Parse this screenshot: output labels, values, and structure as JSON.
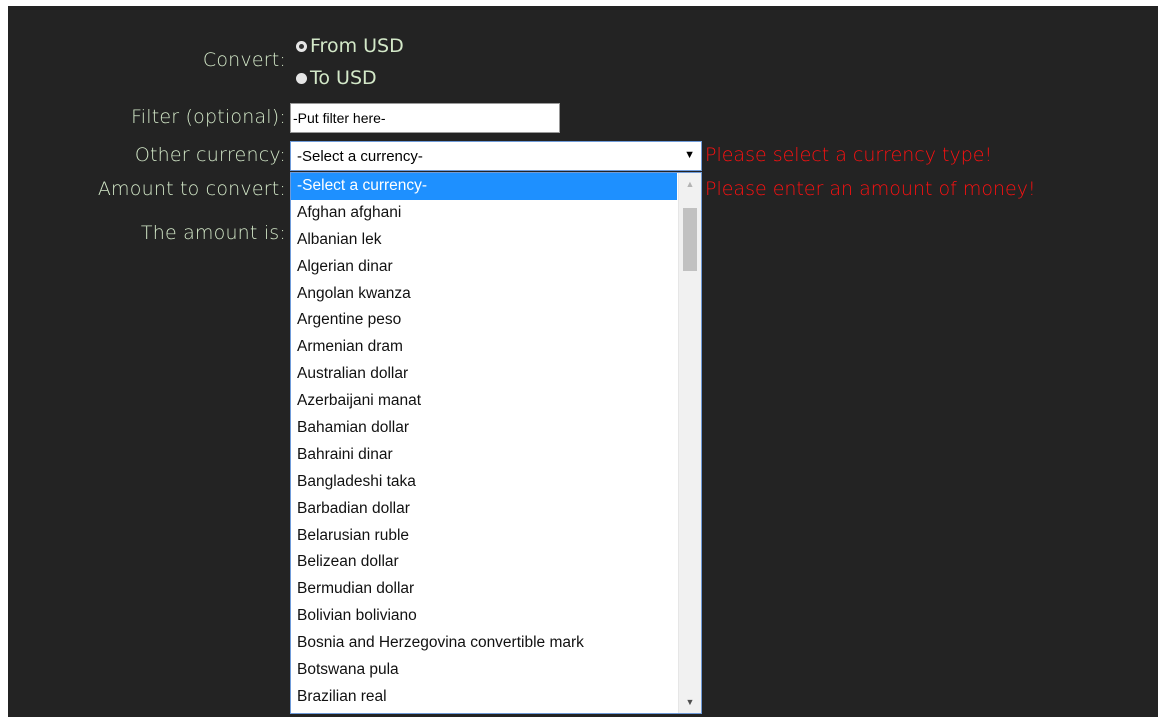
{
  "form": {
    "convert_label": "Convert:",
    "radio_from_label": "From USD",
    "radio_to_label": "To USD",
    "filter_label": "Filter (optional):",
    "filter_value": "-Put filter here-",
    "currency_label": "Other currency:",
    "currency_selected": "-Select a currency-",
    "amount_label": "Amount to convert:",
    "result_label": "The amount is:"
  },
  "errors": {
    "currency_error": "Please select a currency type!",
    "amount_error": "Please enter an amount of money!"
  },
  "dropdown": {
    "options": [
      "-Select a currency-",
      "Afghan afghani",
      "Albanian lek",
      "Algerian dinar",
      "Angolan kwanza",
      "Argentine peso",
      "Armenian dram",
      "Australian dollar",
      "Azerbaijani manat",
      "Bahamian dollar",
      "Bahraini dinar",
      "Bangladeshi taka",
      "Barbadian dollar",
      "Belarusian ruble",
      "Belizean dollar",
      "Bermudian dollar",
      "Bolivian boliviano",
      "Bosnia and Herzegovina convertible mark",
      "Botswana pula",
      "Brazilian real"
    ],
    "highlighted_index": 0
  },
  "colors": {
    "background": "#232323",
    "label_text": "#d3e8c8",
    "error_text": "#ff1010",
    "highlight": "#1e90ff"
  }
}
